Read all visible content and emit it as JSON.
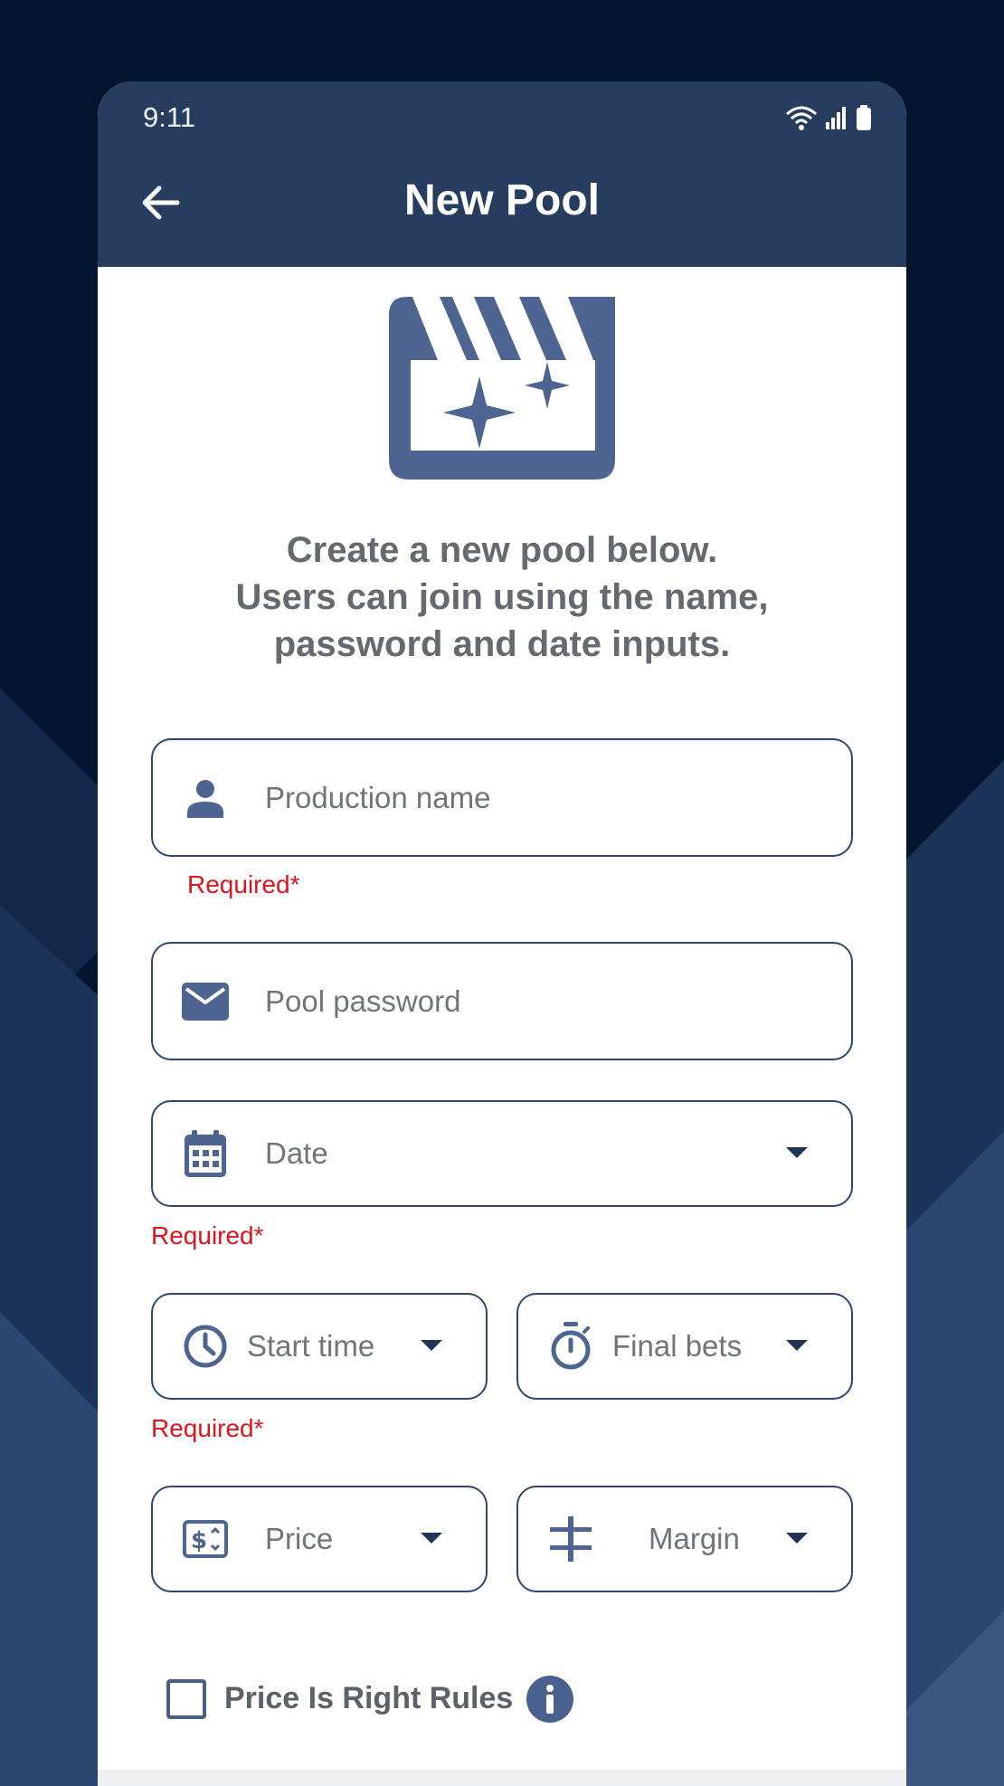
{
  "status_bar": {
    "time": "9:11"
  },
  "app_bar": {
    "title": "New Pool"
  },
  "intro": {
    "lines": [
      "Create a new pool below.",
      "Users can join using the name,",
      "password and date inputs."
    ]
  },
  "form": {
    "production_name": {
      "placeholder": "Production name",
      "error": "Required*"
    },
    "pool_password": {
      "placeholder": "Pool password"
    },
    "date": {
      "placeholder": "Date",
      "error": "Required*"
    },
    "start_time": {
      "placeholder": "Start time",
      "error": "Required*"
    },
    "final_bets": {
      "placeholder": "Final bets"
    },
    "price": {
      "placeholder": "Price"
    },
    "margin": {
      "placeholder": "Margin"
    },
    "price_is_right": {
      "label": "Price Is Right Rules",
      "checked": false
    }
  },
  "colors": {
    "background": "#041530",
    "app_bar": "#273d5f",
    "accent": "#4a6190",
    "field_border": "#2f4770",
    "error": "#e0141e"
  },
  "icons": {
    "back": "arrow-left-icon",
    "hero": "clapperboard-sparkle-icon",
    "production_name": "person-icon",
    "pool_password": "envelope-icon",
    "date": "calendar-icon",
    "start_time": "clock-icon",
    "final_bets": "stopwatch-icon",
    "price": "price-tag-icon",
    "margin": "margin-icon",
    "info": "info-icon"
  }
}
